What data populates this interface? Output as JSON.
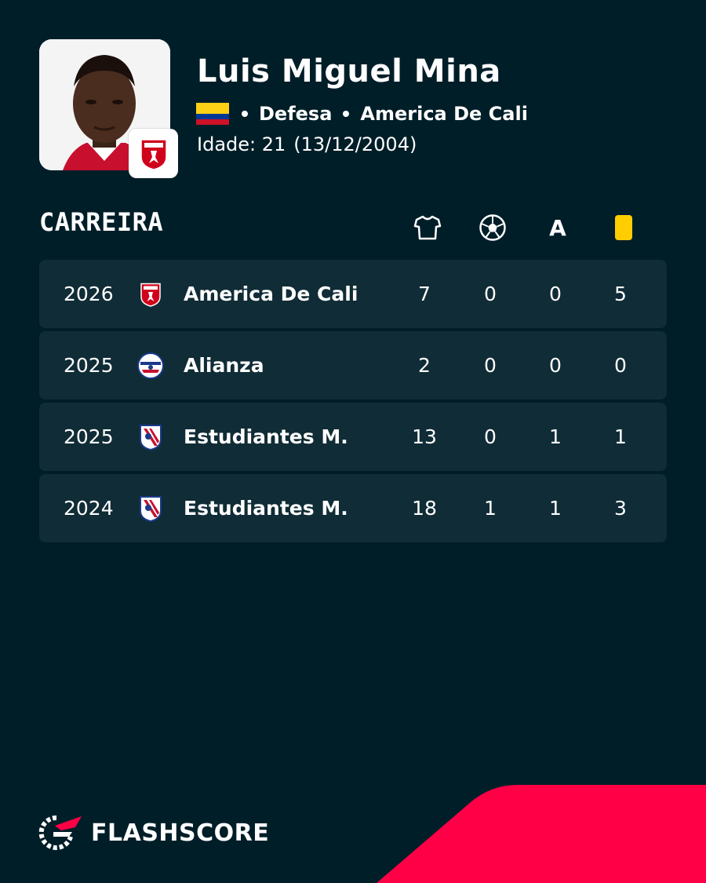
{
  "player": {
    "name": "Luis Miguel Mina",
    "flag_icon": "colombia-flag-icon",
    "position": "Defesa",
    "club": "America De Cali",
    "club_badge_icon": "america-de-cali-crest-icon",
    "age_label": "Idade: 21",
    "birth_date": "(13/12/2004)"
  },
  "career": {
    "title": "CARREIRA",
    "columns": [
      {
        "icon": "shirt-icon",
        "meaning": "appearances"
      },
      {
        "icon": "football-icon",
        "meaning": "goals"
      },
      {
        "icon": "letter-a-icon",
        "label": "A",
        "meaning": "assists"
      },
      {
        "icon": "yellow-card-icon",
        "meaning": "yellow cards"
      }
    ],
    "rows": [
      {
        "year": "2026",
        "team": "America De Cali",
        "logo": "america-de-cali-crest-icon",
        "apps": "7",
        "goals": "0",
        "assists": "0",
        "yellow": "5"
      },
      {
        "year": "2025",
        "team": "Alianza",
        "logo": "alianza-crest-icon",
        "apps": "2",
        "goals": "0",
        "assists": "0",
        "yellow": "0"
      },
      {
        "year": "2025",
        "team": "Estudiantes M.",
        "logo": "estudiantes-merida-crest-icon",
        "apps": "13",
        "goals": "0",
        "assists": "1",
        "yellow": "1"
      },
      {
        "year": "2024",
        "team": "Estudiantes M.",
        "logo": "estudiantes-merida-crest-icon",
        "apps": "18",
        "goals": "1",
        "assists": "1",
        "yellow": "3"
      }
    ]
  },
  "brand": {
    "name": "FLASHSCORE",
    "logo_icon": "flashscore-logo-icon"
  },
  "colors": {
    "background": "#001e28",
    "row_background": "#102c36",
    "accent_red": "#ff0046",
    "yellow_card": "#ffcd00",
    "text": "#ffffff"
  }
}
